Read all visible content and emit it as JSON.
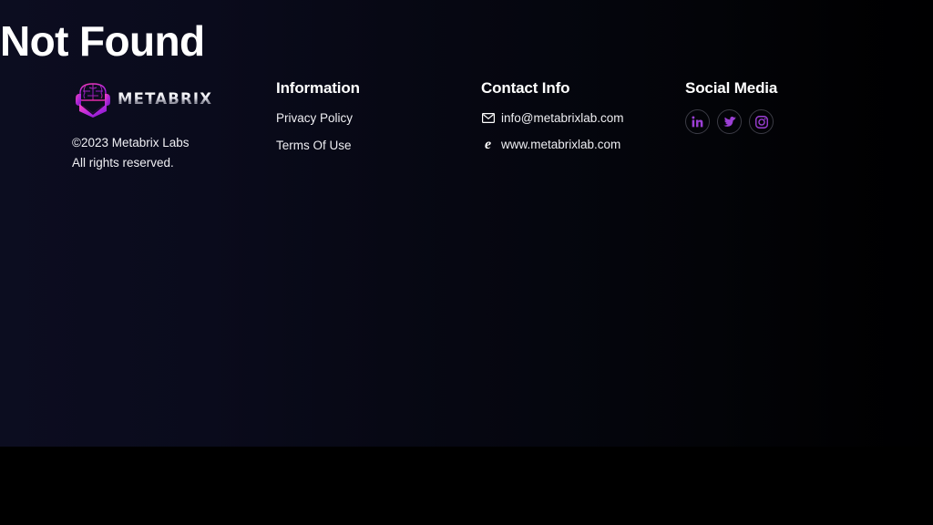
{
  "page": {
    "title": "Not Found",
    "background_left": "#0c0d20",
    "background_right": "#000001"
  },
  "footer": {
    "brand": {
      "logo_icon": "metabrix-brain-headset-icon",
      "wordmark": "METABRIX",
      "copyright_line1": "©2023 Metabrix Labs",
      "copyright_line2": "All rights reserved."
    },
    "information": {
      "heading": "Information",
      "links": [
        {
          "label": "Privacy Policy"
        },
        {
          "label": "Terms Of Use"
        }
      ]
    },
    "contact": {
      "heading": "Contact Info",
      "items": [
        {
          "icon": "envelope-icon",
          "label": "info@metabrixlab.com"
        },
        {
          "icon": "internet-explorer-icon",
          "label": "www.metabrixlab.com"
        }
      ]
    },
    "social": {
      "heading": "Social Media",
      "accent_color": "#9b3fd4",
      "links": [
        {
          "icon": "linkedin-icon",
          "label": "LinkedIn"
        },
        {
          "icon": "twitter-icon",
          "label": "Twitter"
        },
        {
          "icon": "instagram-icon",
          "label": "Instagram"
        }
      ]
    }
  }
}
